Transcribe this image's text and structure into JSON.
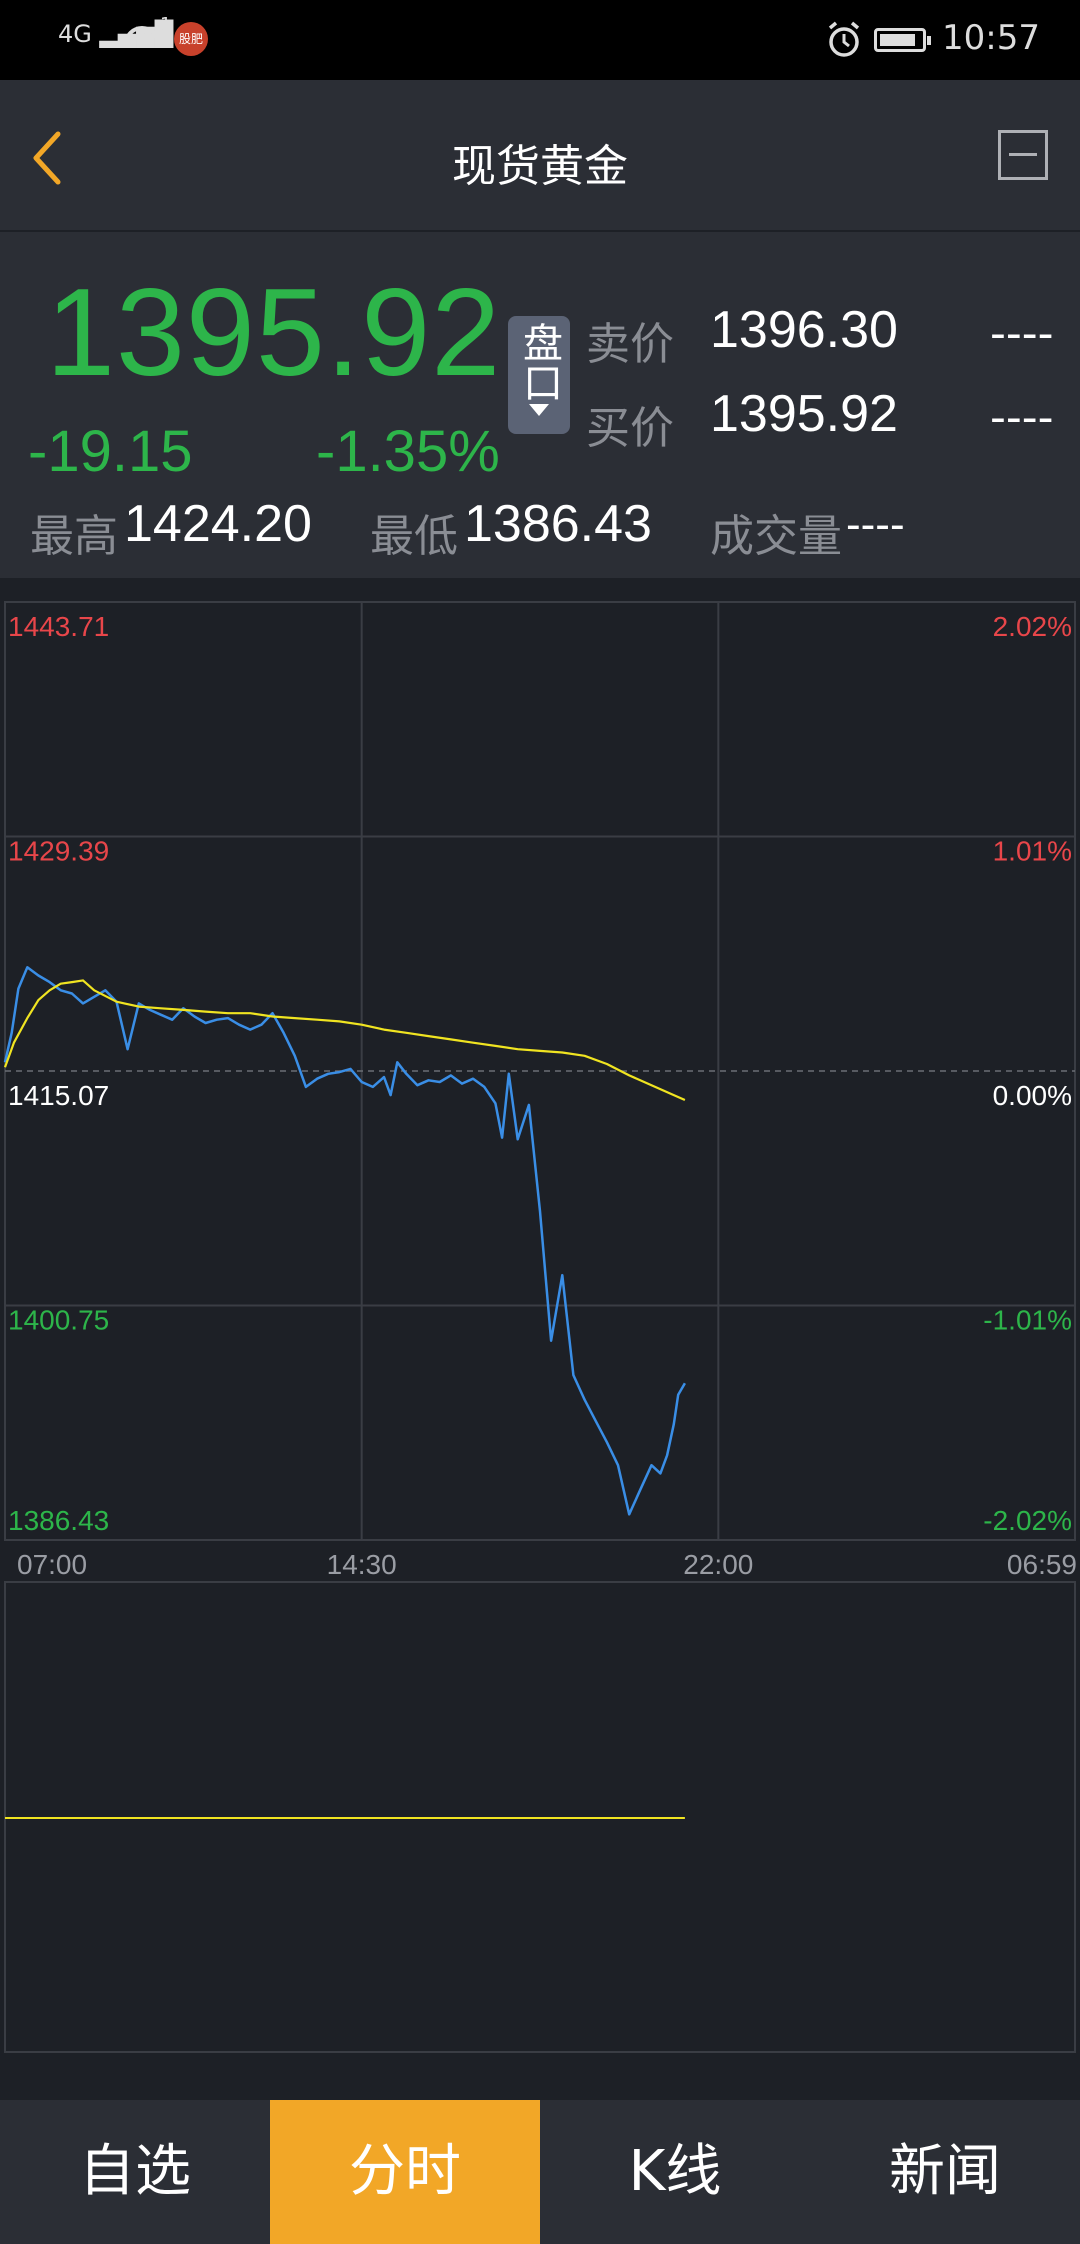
{
  "status": {
    "network": "4G",
    "notif_count": "1",
    "app_badge": "股肥",
    "time": "10:57"
  },
  "nav": {
    "title": "现货黄金"
  },
  "quote": {
    "price": "1395.92",
    "change": "-19.15",
    "change_pct": "-1.35%",
    "pankou_label": "盘口",
    "sell_label": "卖价",
    "sell_value": "1396.30",
    "sell_extra": "----",
    "buy_label": "买价",
    "buy_value": "1395.92",
    "buy_extra": "----",
    "high_label": "最高",
    "high_value": "1424.20",
    "low_label": "最低",
    "low_value": "1386.43",
    "volume_label": "成交量",
    "volume_value": "----",
    "up_color": "#e8464a",
    "down_color": "#2db54a"
  },
  "chart_data": {
    "type": "line",
    "y_labels_left": [
      "1443.71",
      "1429.39",
      "1415.07",
      "1400.75",
      "1386.43"
    ],
    "y_labels_right": [
      "2.02%",
      "1.01%",
      "0.00%",
      "-1.01%",
      "-2.02%"
    ],
    "x_labels": [
      "07:00",
      "14:30",
      "22:00",
      "06:59"
    ],
    "ylim": [
      1386.43,
      1443.71
    ],
    "reference": 1415.07,
    "series": [
      {
        "color": "#3a8ee6",
        "x": [
          0,
          0.3,
          0.6,
          1.0,
          1.5,
          2.0,
          2.5,
          3.0,
          3.5,
          4.0,
          4.5,
          5.0,
          5.5,
          6.0,
          6.5,
          7.0,
          7.5,
          8.0,
          8.5,
          9.0,
          9.5,
          10.0,
          10.5,
          11.0,
          11.5,
          12.0,
          12.5,
          13.0,
          13.5,
          14.0,
          14.5,
          15.0,
          15.5,
          16.0,
          16.5,
          17.0,
          17.3,
          17.6,
          18.0,
          18.5,
          19.0,
          19.5,
          20.0,
          20.5,
          21.0,
          21.5,
          22.0,
          22.3,
          22.6,
          23.0,
          23.5,
          24.0,
          24.5,
          25.0,
          25.5,
          26.0,
          26.5,
          27.0,
          27.5,
          28.0,
          28.5,
          29.0,
          29.4,
          29.7,
          30.0,
          30.2,
          30.5
        ],
        "y": [
          1415.6,
          1417.4,
          1420.1,
          1421.4,
          1420.9,
          1420.5,
          1420.0,
          1419.8,
          1419.2,
          1419.6,
          1420.0,
          1419.3,
          1416.4,
          1419.2,
          1418.8,
          1418.5,
          1418.2,
          1418.9,
          1418.4,
          1418.0,
          1418.2,
          1418.3,
          1417.9,
          1417.6,
          1417.9,
          1418.6,
          1417.4,
          1416.0,
          1414.1,
          1414.6,
          1414.9,
          1415.0,
          1415.2,
          1414.4,
          1414.1,
          1414.7,
          1413.6,
          1415.6,
          1414.9,
          1414.2,
          1414.5,
          1414.4,
          1414.8,
          1414.3,
          1414.6,
          1414.1,
          1413.1,
          1411.0,
          1414.9,
          1410.9,
          1413.0,
          1406.5,
          1398.6,
          1402.6,
          1396.5,
          1395.0,
          1393.7,
          1392.4,
          1391.0,
          1388.0,
          1389.5,
          1391.0,
          1390.5,
          1391.6,
          1393.5,
          1395.3,
          1396.0
        ]
      },
      {
        "color": "#f0e421",
        "x": [
          0,
          0.4,
          1.0,
          1.5,
          2.0,
          2.5,
          3.0,
          3.5,
          4.0,
          5.0,
          6.0,
          7.0,
          8.0,
          9.0,
          10.0,
          11.0,
          12.0,
          13.0,
          14.0,
          15.0,
          16.0,
          17.0,
          18.0,
          19.0,
          20.0,
          21.0,
          22.0,
          23.0,
          24.0,
          25.0,
          26.0,
          27.0,
          28.0,
          29.0,
          30.0,
          30.5
        ],
        "y": [
          1415.3,
          1416.8,
          1418.3,
          1419.4,
          1420.0,
          1420.4,
          1420.5,
          1420.6,
          1420.0,
          1419.3,
          1419.0,
          1418.9,
          1418.8,
          1418.7,
          1418.6,
          1418.6,
          1418.4,
          1418.3,
          1418.2,
          1418.1,
          1417.9,
          1417.6,
          1417.4,
          1417.2,
          1417.0,
          1416.8,
          1416.6,
          1416.4,
          1416.3,
          1416.2,
          1416.0,
          1415.5,
          1414.8,
          1414.2,
          1413.6,
          1413.3
        ]
      }
    ]
  },
  "tabs": [
    {
      "label": "自选"
    },
    {
      "label": "分时"
    },
    {
      "label": "K线"
    },
    {
      "label": "新闻"
    }
  ]
}
